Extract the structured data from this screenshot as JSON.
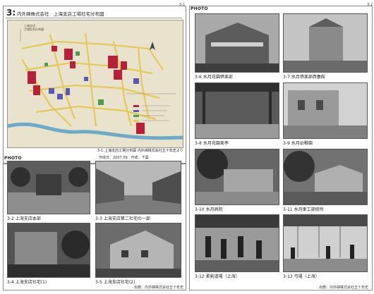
{
  "pages": {
    "left": "3-1",
    "right": "3-2"
  },
  "section": {
    "number": "3:",
    "title": "内外綿株式会社　上海支店工場社宅分布図"
  },
  "map": {
    "inset_title": "上海支店\n工場社宅分布図",
    "caption": {
      "num": "3-1",
      "text": "上海支店工場分布図 内外綿株式会社五十年史より"
    },
    "credit": "作成日：2007.09　作成：千葉",
    "colors": {
      "paper": "#e9e3cd",
      "road": "#e3c85a",
      "factory": "#b8203a",
      "housing": "#5a58b3",
      "green": "#4f9b4c",
      "water": "#6fa9c7"
    }
  },
  "photo_label": "PHOTO",
  "left_photos": [
    {
      "num": "3-2",
      "text": "上海支店本部",
      "tone": "#5d5d5d"
    },
    {
      "num": "3-3",
      "text": "上海支店第二社宅の一部",
      "tone": "#7b7b7b"
    },
    {
      "num": "3-4",
      "text": "上海支店社宅(1)",
      "tone": "#545454"
    },
    {
      "num": "3-5",
      "text": "上海支店社宅(2)",
      "tone": "#6c6c6c"
    }
  ],
  "left_source": "出典：内外綿株式会社五十年史",
  "right_photos": [
    {
      "num": "3-6",
      "text": "水月花園倶楽部",
      "tone": "#6a6a6a"
    },
    {
      "num": "3-7",
      "text": "水月倶楽部西養館",
      "tone": "#8a8a8a"
    },
    {
      "num": "3-8",
      "text": "水月花園美亭",
      "tone": "#5a5a5a"
    },
    {
      "num": "3-9",
      "text": "水月幼稚園",
      "tone": "#7f7f7f"
    },
    {
      "num": "3-10",
      "text": "水月病院",
      "tone": "#666666"
    },
    {
      "num": "3-11",
      "text": "水月車工部修所",
      "tone": "#727272"
    },
    {
      "num": "3-12",
      "text": "柔剣道場（上海）",
      "tone": "#5f5f5f"
    },
    {
      "num": "3-13",
      "text": "弓場（上海）",
      "tone": "#8c8c8c"
    }
  ],
  "right_source": "出典：内外綿株式会社五十年史"
}
